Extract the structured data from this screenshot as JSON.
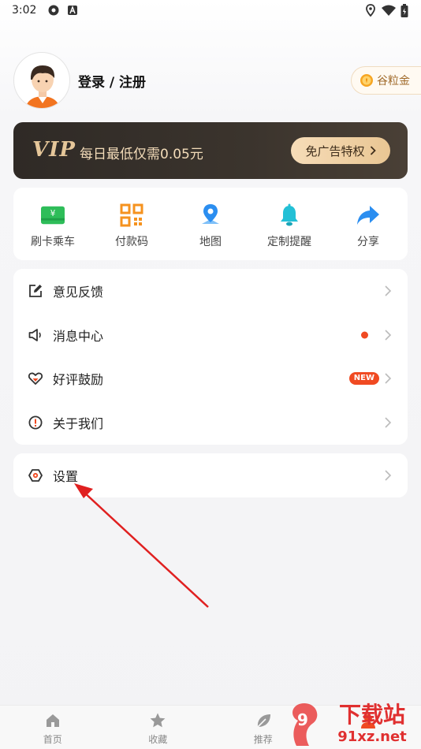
{
  "status_bar": {
    "time": "3:02"
  },
  "profile": {
    "login_text": "登录 / 注册",
    "coin_label": "谷粒金"
  },
  "vip": {
    "logo": "VIP",
    "text": "每日最低仅需0.05元",
    "button_label": "免广告特权"
  },
  "quick_actions": [
    {
      "label": "刷卡乘车",
      "icon": "card-icon",
      "color": "#2ebd59"
    },
    {
      "label": "付款码",
      "icon": "qrcode-icon",
      "color": "#f5921e"
    },
    {
      "label": "地图",
      "icon": "map-pin-icon",
      "color": "#2b8ef0"
    },
    {
      "label": "定制提醒",
      "icon": "bell-icon",
      "color": "#23c0d6"
    },
    {
      "label": "分享",
      "icon": "share-icon",
      "color": "#2b8ef0"
    }
  ],
  "menu": {
    "items": [
      {
        "label": "意见反馈",
        "icon": "feedback-icon"
      },
      {
        "label": "消息中心",
        "icon": "speaker-icon",
        "has_dot": true
      },
      {
        "label": "好评鼓励",
        "icon": "heart-icon",
        "badge": "NEW"
      },
      {
        "label": "关于我们",
        "icon": "info-icon"
      }
    ],
    "settings": {
      "label": "设置",
      "icon": "settings-icon"
    }
  },
  "tabs": [
    {
      "label": "首页",
      "icon": "home-icon"
    },
    {
      "label": "收藏",
      "icon": "star-icon"
    },
    {
      "label": "推荐",
      "icon": "leaf-icon"
    },
    {
      "label": "",
      "icon": "profile-icon"
    }
  ],
  "watermark": {
    "text": "下载站",
    "url_text": "91xz.net",
    "logo_text": "9"
  },
  "colors": {
    "accent": "#f04a22",
    "vip_gold": "#e6c79a",
    "background": "#f3f3f5"
  }
}
